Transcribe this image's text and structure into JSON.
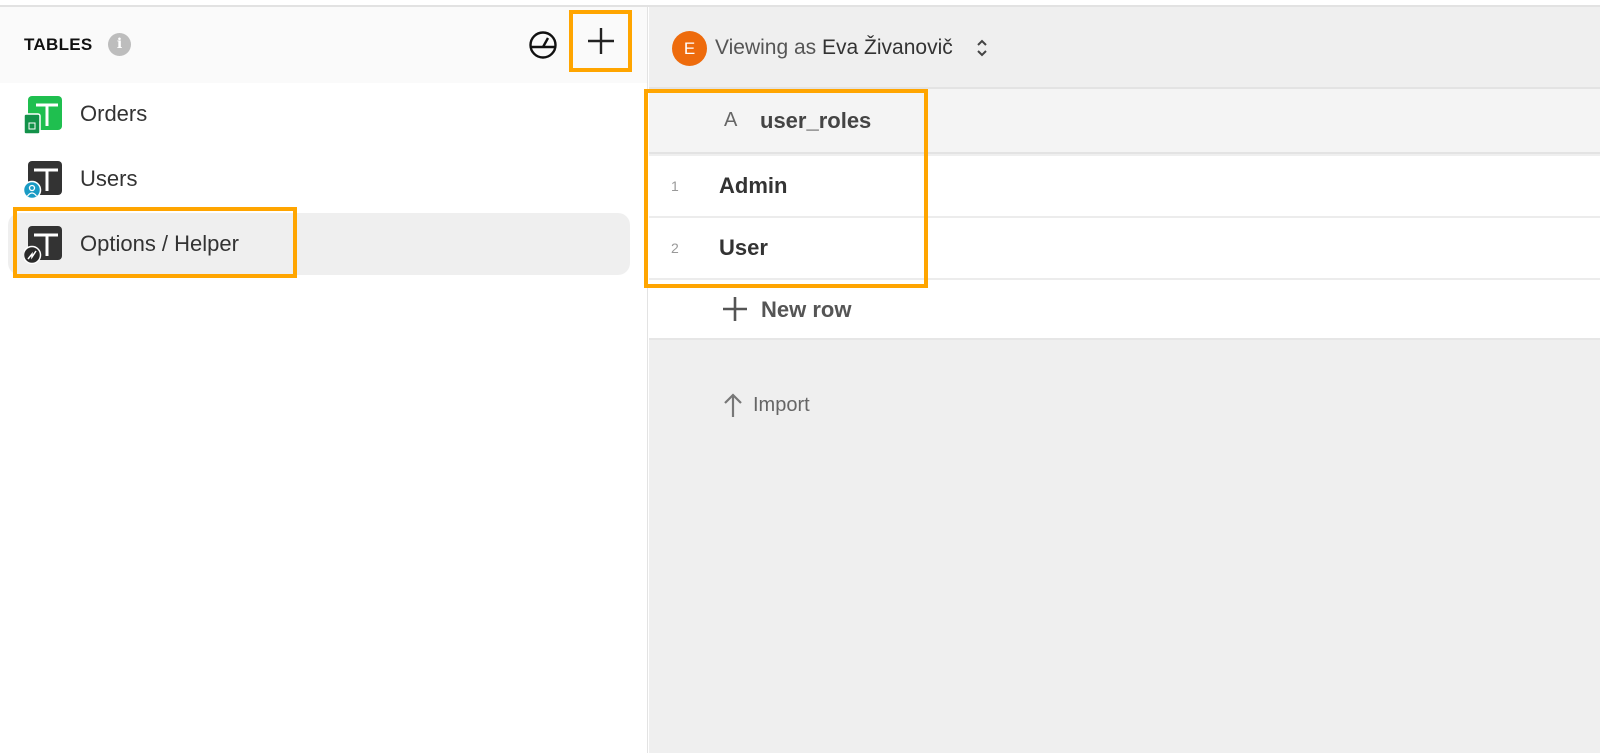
{
  "sidebar": {
    "title": "TABLES",
    "info_icon": "i",
    "items": [
      {
        "label": "Orders",
        "icon": "sheet-table-icon",
        "active": false
      },
      {
        "label": "Users",
        "icon": "users-table-icon",
        "active": false
      },
      {
        "label": "Options / Helper",
        "icon": "helper-table-icon",
        "active": true
      }
    ]
  },
  "header": {
    "avatar_initial": "E",
    "viewing_prefix": "Viewing as ",
    "viewing_user": "Eva Živanovič"
  },
  "grid": {
    "column": {
      "type_glyph": "A",
      "name": "user_roles"
    },
    "rows": [
      {
        "num": "1",
        "value": "Admin"
      },
      {
        "num": "2",
        "value": "User"
      }
    ],
    "new_row_label": "New row",
    "import_label": "Import"
  },
  "colors": {
    "highlight": "#ffa500",
    "avatar": "#ee6b0c",
    "sheet_green": "#1db954"
  }
}
